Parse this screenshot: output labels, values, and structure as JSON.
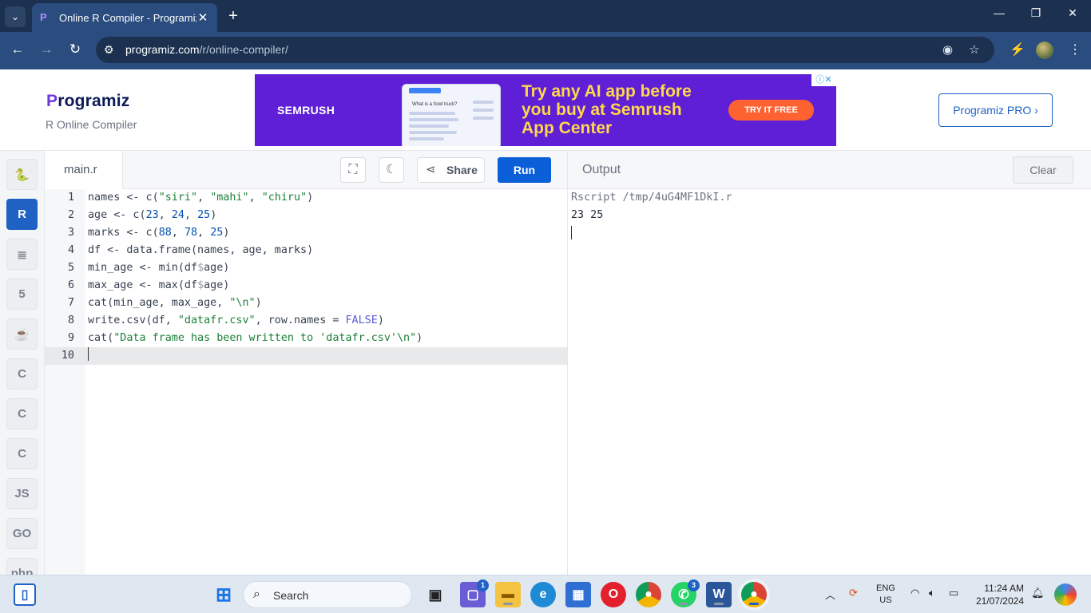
{
  "browser": {
    "tab_title": "Online R Compiler - Programiz",
    "tab_favicon": "P",
    "close_glyph": "✕",
    "new_tab_glyph": "+",
    "url_domain": "programiz.com",
    "url_path": "/r/online-compiler/"
  },
  "header": {
    "logo": "Programiz",
    "logo_first": "P",
    "logo_rest": "rogramiz",
    "subtitle": "R Online Compiler",
    "pro_button": "Programiz PRO ›"
  },
  "ad": {
    "brand": "SEMRUSH",
    "screenshot_question": "What is a food truck?",
    "headline": [
      "Try any AI app before",
      "you buy at Semrush",
      "App Center"
    ],
    "cta": "TRY IT FREE"
  },
  "rail": {
    "items": [
      {
        "name": "python",
        "glyph": "🐍"
      },
      {
        "name": "r",
        "glyph": "R"
      },
      {
        "name": "sql",
        "glyph": "≣"
      },
      {
        "name": "html",
        "glyph": "5"
      },
      {
        "name": "java",
        "glyph": "☕"
      },
      {
        "name": "c",
        "glyph": "C"
      },
      {
        "name": "cpp",
        "glyph": "C"
      },
      {
        "name": "csharp",
        "glyph": "C"
      },
      {
        "name": "javascript",
        "glyph": "JS"
      },
      {
        "name": "go",
        "glyph": "GO"
      },
      {
        "name": "php",
        "glyph": "php"
      }
    ],
    "active_index": 1
  },
  "editor": {
    "filename": "main.r",
    "share_label": "Share",
    "run_label": "Run",
    "current_line": 10,
    "lines": [
      {
        "n": "1",
        "tokens": [
          [
            "names <- c(",
            ""
          ],
          [
            "\"siri\"",
            "str"
          ],
          [
            ", ",
            ""
          ],
          [
            "\"mahi\"",
            "str"
          ],
          [
            ", ",
            ""
          ],
          [
            "\"chiru\"",
            "str"
          ],
          [
            ")",
            ""
          ]
        ]
      },
      {
        "n": "2",
        "tokens": [
          [
            "age <- c(",
            ""
          ],
          [
            "23",
            "num"
          ],
          [
            ", ",
            ""
          ],
          [
            "24",
            "num"
          ],
          [
            ", ",
            ""
          ],
          [
            "25",
            "num"
          ],
          [
            ")",
            ""
          ]
        ]
      },
      {
        "n": "3",
        "tokens": [
          [
            "marks <- c(",
            ""
          ],
          [
            "88",
            "num"
          ],
          [
            ", ",
            ""
          ],
          [
            "78",
            "num"
          ],
          [
            ", ",
            ""
          ],
          [
            "25",
            "num"
          ],
          [
            ")",
            ""
          ]
        ]
      },
      {
        "n": "4",
        "tokens": [
          [
            "df <- data.frame(names, age, marks)",
            ""
          ]
        ]
      },
      {
        "n": "5",
        "tokens": [
          [
            "min_age <- min(df",
            ""
          ],
          [
            "$",
            "op"
          ],
          [
            "age)",
            ""
          ]
        ]
      },
      {
        "n": "6",
        "tokens": [
          [
            "max_age <- max(df",
            ""
          ],
          [
            "$",
            "op"
          ],
          [
            "age)",
            ""
          ]
        ]
      },
      {
        "n": "7",
        "tokens": [
          [
            "cat(min_age, max_age, ",
            ""
          ],
          [
            "\"\\n\"",
            "str"
          ],
          [
            ")",
            ""
          ]
        ]
      },
      {
        "n": "8",
        "tokens": [
          [
            "write.csv(df, ",
            ""
          ],
          [
            "\"datafr.csv\"",
            "str"
          ],
          [
            ", row.names = ",
            ""
          ],
          [
            "FALSE",
            "kw"
          ],
          [
            ")",
            ""
          ]
        ]
      },
      {
        "n": "9",
        "tokens": [
          [
            "cat(",
            ""
          ],
          [
            "\"Data frame has been written to 'datafr.csv'\\n\"",
            "str"
          ],
          [
            ")",
            ""
          ]
        ]
      },
      {
        "n": "10",
        "tokens": []
      }
    ]
  },
  "output": {
    "title": "Output",
    "clear_label": "Clear",
    "lines": [
      "Rscript /tmp/4uG4MF1DkI.r",
      "23 25"
    ]
  },
  "taskbar": {
    "search_label": "Search",
    "chat_badge": "1",
    "whatsapp_badge": "3",
    "lang_line1": "ENG",
    "lang_line2": "US",
    "time": "11:24 AM",
    "date": "21/07/2024"
  }
}
